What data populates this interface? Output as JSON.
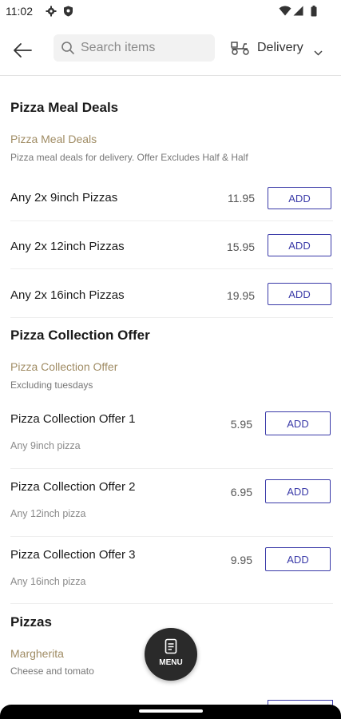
{
  "status_bar": {
    "time": "11:02"
  },
  "header": {
    "search_placeholder": "Search items",
    "delivery_label": "Delivery"
  },
  "sections": [
    {
      "title": "Pizza Meal Deals",
      "category": "Pizza Meal Deals",
      "description": "Pizza meal deals for delivery. Offer Excludes Half & Half",
      "items": [
        {
          "name": "Any 2x 9inch Pizzas",
          "price": "11.95",
          "button": "ADD"
        },
        {
          "name": "Any 2x 12inch Pizzas",
          "price": "15.95",
          "button": "ADD"
        },
        {
          "name": "Any 2x 16inch Pizzas",
          "price": "19.95",
          "button": "ADD"
        }
      ]
    },
    {
      "title": "Pizza Collection Offer",
      "category": "Pizza Collection Offer",
      "description": "Excluding tuesdays",
      "items": [
        {
          "name": "Pizza Collection Offer 1",
          "subtitle": "Any 9inch pizza",
          "price": "5.95",
          "button": "ADD"
        },
        {
          "name": "Pizza Collection Offer 2",
          "subtitle": "Any 12inch pizza",
          "price": "6.95",
          "button": "ADD"
        },
        {
          "name": "Pizza Collection Offer 3",
          "subtitle": "Any 16inch pizza",
          "price": "9.95",
          "button": "ADD"
        }
      ]
    },
    {
      "title": "Pizzas",
      "category": "Margherita",
      "description": "Cheese and tomato"
    }
  ],
  "fab": {
    "label": "MENU"
  },
  "colors": {
    "accent": "#3a3aa8",
    "category": "#a08c64",
    "fab": "#2a2a2a"
  },
  "icons": [
    "gear-icon",
    "shield-icon",
    "wifi-icon",
    "signal-icon",
    "battery-icon",
    "back-arrow-icon",
    "search-icon",
    "scooter-icon",
    "chevron-down-icon",
    "menu-document-icon"
  ]
}
